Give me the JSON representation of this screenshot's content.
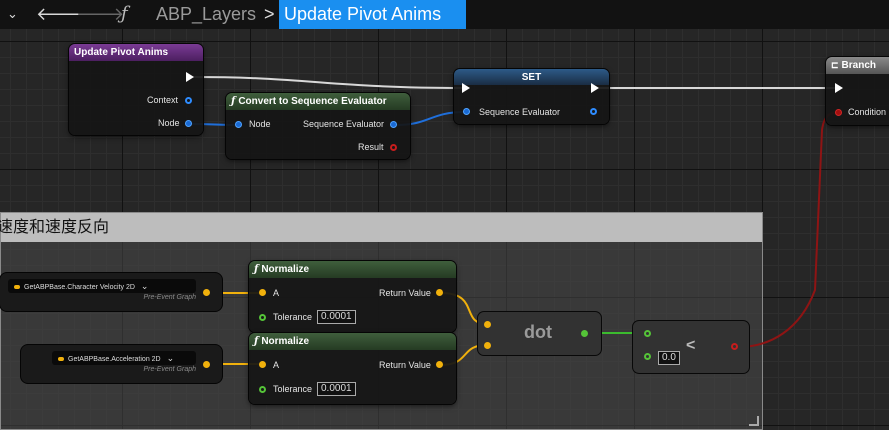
{
  "breadcrumb": {
    "graph_name": "ABP_Layers",
    "separator": ">",
    "current_function": "Update Pivot Anims",
    "function_icon": "ƒ"
  },
  "colors": {
    "accent": "#1a8ff0",
    "function_header": "#652d7e",
    "pure_function_header": "#2e4a2c",
    "exec_wire": "#ffffff",
    "object_wire": "#1f6fdb",
    "float_wire": "#f1b10c",
    "bool_wire": "#a01515",
    "green_wire": "#3bbb2e"
  },
  "entry_node": {
    "title": "Update Pivot Anims",
    "pins": [
      "Context",
      "Node"
    ]
  },
  "convert_node": {
    "title": "Convert to Sequence Evaluator",
    "in_pin": "Node",
    "out_pin": "Sequence Evaluator",
    "result_pin": "Result"
  },
  "set_node": {
    "title": "SET",
    "pin": "Sequence Evaluator"
  },
  "branch_node": {
    "title": "Branch",
    "pin": "Condition"
  },
  "comment": {
    "text": "速度和速度反向"
  },
  "getter_velocity": {
    "label": "GetABPBase.Character Velocity 2D",
    "sub": "Pre-Event Graph"
  },
  "getter_accel": {
    "label": "GetABPBase.Acceleration 2D",
    "sub": "Pre-Event Graph"
  },
  "normalize_1": {
    "title": "Normalize",
    "in_pin": "A",
    "out_pin": "Return Value",
    "tolerance_label": "Tolerance",
    "tolerance_value": "0.0001"
  },
  "normalize_2": {
    "title": "Normalize",
    "in_pin": "A",
    "out_pin": "Return Value",
    "tolerance_label": "Tolerance",
    "tolerance_value": "0.0001"
  },
  "dot_node": {
    "label": "dot"
  },
  "less_node": {
    "symbol": "<",
    "value": "0.0"
  }
}
